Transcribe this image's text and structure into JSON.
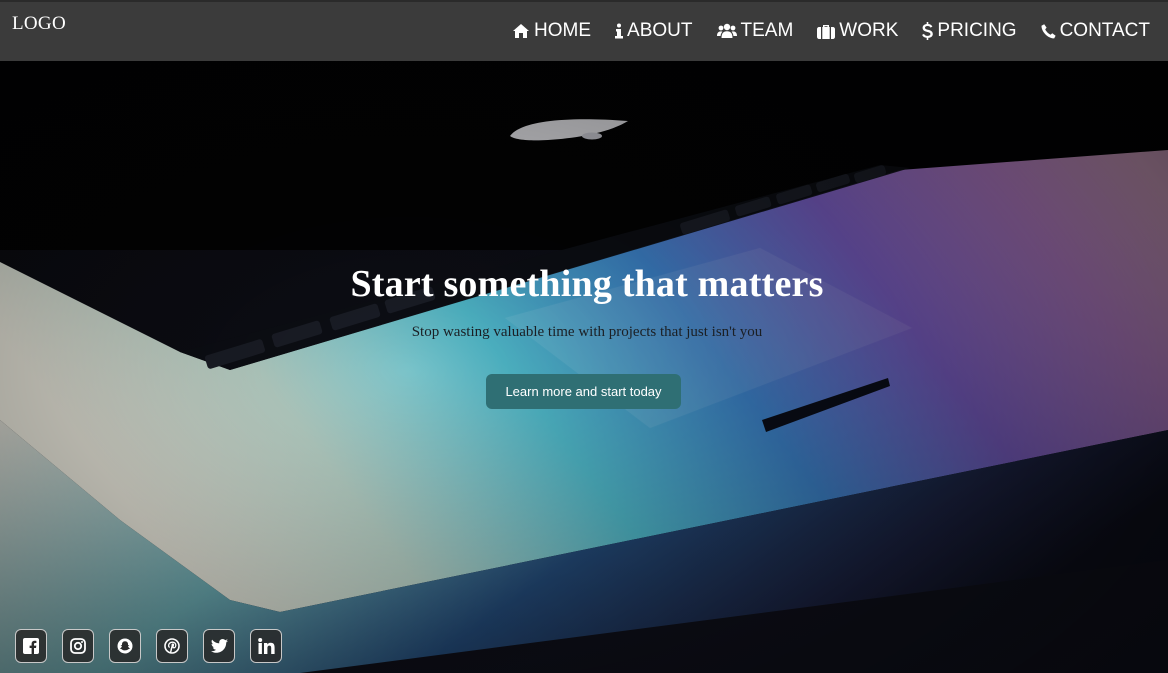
{
  "navbar": {
    "logo": "LOGO",
    "items": [
      {
        "label": "HOME",
        "icon": "home-icon"
      },
      {
        "label": "ABOUT",
        "icon": "info-icon"
      },
      {
        "label": "TEAM",
        "icon": "users-icon"
      },
      {
        "label": "WORK",
        "icon": "briefcase-icon"
      },
      {
        "label": "PRICING",
        "icon": "dollar-icon"
      },
      {
        "label": "CONTACT",
        "icon": "phone-icon"
      }
    ]
  },
  "hero": {
    "title": "Start something that matters",
    "subtitle": "Stop wasting valuable time with projects that just isn't you",
    "cta_label": "Learn more and start today"
  },
  "social": [
    {
      "icon": "facebook-icon"
    },
    {
      "icon": "instagram-icon"
    },
    {
      "icon": "snapchat-icon"
    },
    {
      "icon": "pinterest-icon"
    },
    {
      "icon": "twitter-icon"
    },
    {
      "icon": "linkedin-icon"
    }
  ],
  "colors": {
    "navbar_bg": "#3b3b3b",
    "cta_bg": "#2f6f74",
    "text": "#ffffff"
  }
}
